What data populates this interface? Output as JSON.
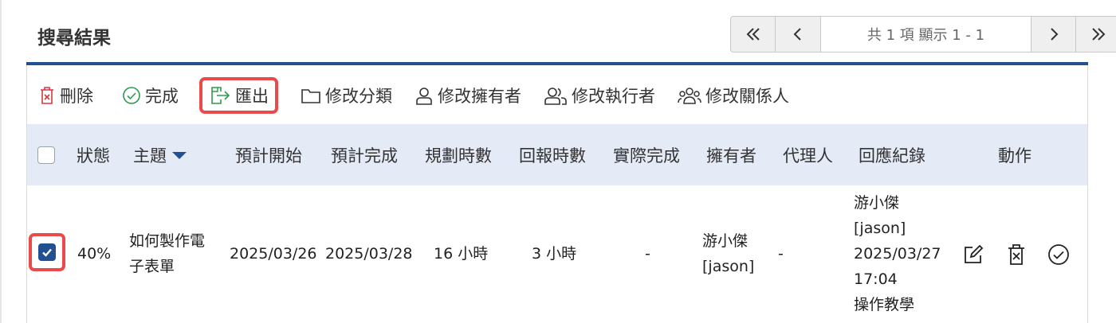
{
  "panel": {
    "title": "搜尋結果"
  },
  "pager": {
    "info": "共 1 項 顯示 1 - 1"
  },
  "toolbar": {
    "delete": "刪除",
    "complete": "完成",
    "export": "匯出",
    "change_category": "修改分類",
    "change_owner": "修改擁有者",
    "change_assignee": "修改執行者",
    "change_related": "修改關係人"
  },
  "table": {
    "columns": [
      "狀態",
      "主題",
      "預計開始",
      "預計完成",
      "規劃時數",
      "回報時數",
      "實際完成",
      "擁有者",
      "代理人",
      "回應紀錄",
      "動作"
    ],
    "rows": [
      {
        "checked": true,
        "status": "40%",
        "subject_line1": "如何製作電",
        "subject_line2": "子表單",
        "planned_start": "2025/03/26",
        "planned_finish": "2025/03/28",
        "planned_hours": "16 小時",
        "reported_hours": "3 小時",
        "actual_finish": "-",
        "owner_line1": "游小傑",
        "owner_line2": "[jason]",
        "agent": "-",
        "response_lines": [
          "游小傑",
          "[jason]",
          "2025/03/27",
          "17:04",
          "操作教學"
        ]
      }
    ]
  },
  "colors": {
    "accent": "#234f93",
    "header_bg": "#e4eaf6",
    "highlight": "#ea4a4a",
    "delete_icon": "#d9363e",
    "complete_icon": "#2e9a4d",
    "export_icon": "#2e9a4d"
  }
}
